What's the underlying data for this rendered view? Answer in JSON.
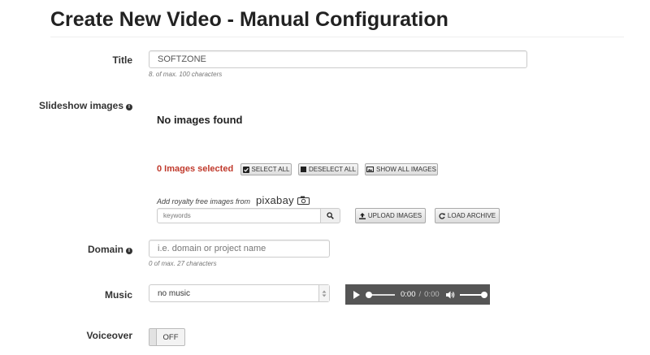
{
  "page": {
    "title": "Create New Video - Manual Configuration"
  },
  "title_field": {
    "label": "Title",
    "value": "SOFTZONE",
    "hint": "8. of max. 100 characters"
  },
  "slideshow": {
    "label": "Slideshow images",
    "info_icon": "info-circle-icon",
    "empty_text": "No images found",
    "selected_text": "0 Images selected",
    "buttons": {
      "select_all": "SELECT ALL",
      "deselect_all": "DESELECT ALL",
      "show_all": "SHOW ALL IMAGES"
    },
    "royalty_text": "Add royalty free images from",
    "provider": "pixabay",
    "keywords_placeholder": "keywords",
    "upload_label": "UPLOAD IMAGES",
    "load_archive_label": "LOAD ARCHIVE"
  },
  "domain_field": {
    "label": "Domain",
    "placeholder": "i.e. domain or project name",
    "hint": "0 of max. 27 characters"
  },
  "music": {
    "label": "Music",
    "selected": "no music",
    "player": {
      "current_time": "0:00",
      "separator": "/",
      "duration": "0:00",
      "progress": 0,
      "volume": 1.0
    }
  },
  "voiceover": {
    "label": "Voiceover",
    "state": "OFF"
  },
  "colors": {
    "selected_count": "#c0392b",
    "player_bg": "#555555"
  }
}
